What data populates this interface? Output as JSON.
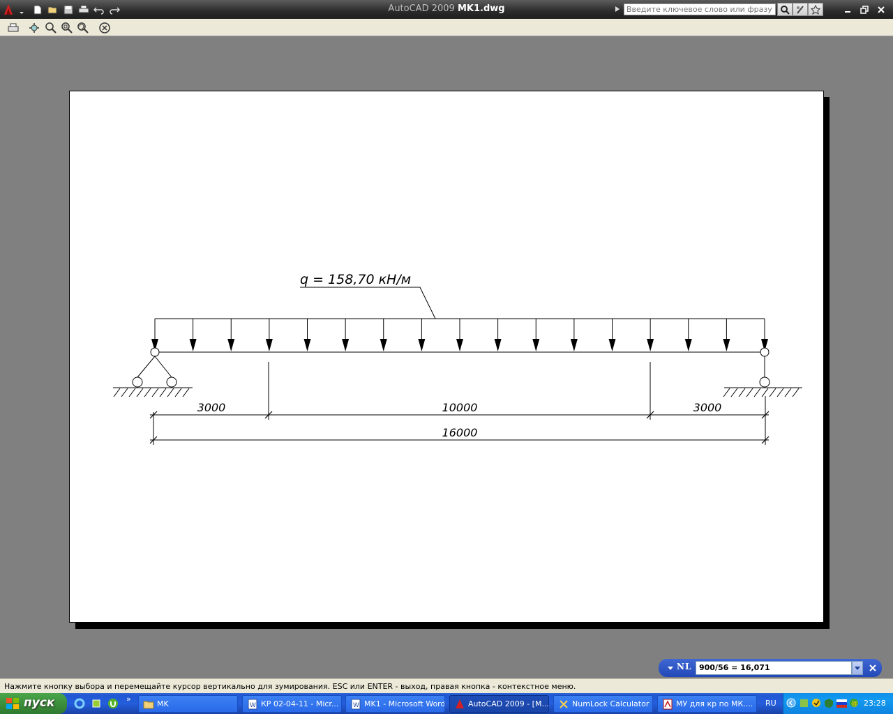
{
  "window": {
    "app_name": "AutoCAD 2009",
    "file_name": "MK1.dwg",
    "search_placeholder": "Введите ключевое слово или фразу"
  },
  "drawing": {
    "load_label": "q = 158,70 кН/м",
    "dims": {
      "left_span": "3000",
      "middle_span": "10000",
      "right_span": "3000",
      "total_span": "16000"
    }
  },
  "calculator": {
    "badge": "NL",
    "expression": "900/56 = 16,071"
  },
  "status_line": "Нажмите кнопку выбора и перемещайте курсор вертикально для зумирования. ESC или ENTER - выход, правая кнопка - контекстное меню.",
  "taskbar": {
    "start_label": "пуск",
    "more": "»",
    "tasks": [
      {
        "label": "MK",
        "icon": "folder-icon"
      },
      {
        "label": "КР 02-04-11 - Micr...",
        "icon": "word-icon"
      },
      {
        "label": "MK1 - Microsoft Word",
        "icon": "word-icon"
      },
      {
        "label": "AutoCAD 2009 - [M...",
        "icon": "autocad-icon"
      },
      {
        "label": "NumLock Calculator",
        "icon": "calculator-icon"
      },
      {
        "label": "МУ для кр по МК....",
        "icon": "pdf-icon"
      }
    ],
    "language": "RU",
    "clock": "23:28"
  },
  "colors": {
    "titlebar": "#2b2b2b",
    "workspace": "#808080",
    "taskbar": "#245edc",
    "start": "#3c8f3c"
  }
}
